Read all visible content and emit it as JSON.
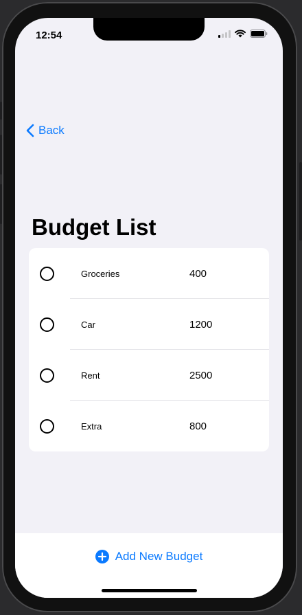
{
  "status_bar": {
    "time": "12:54"
  },
  "navigation": {
    "back_label": "Back"
  },
  "page": {
    "title": "Budget List"
  },
  "budgets": [
    {
      "name": "Groceries",
      "amount": "400"
    },
    {
      "name": "Car",
      "amount": "1200"
    },
    {
      "name": "Rent",
      "amount": "2500"
    },
    {
      "name": "Extra",
      "amount": "800"
    }
  ],
  "toolbar": {
    "add_label": "Add New Budget"
  },
  "colors": {
    "accent": "#0a7aff",
    "background": "#f2f1f7"
  }
}
